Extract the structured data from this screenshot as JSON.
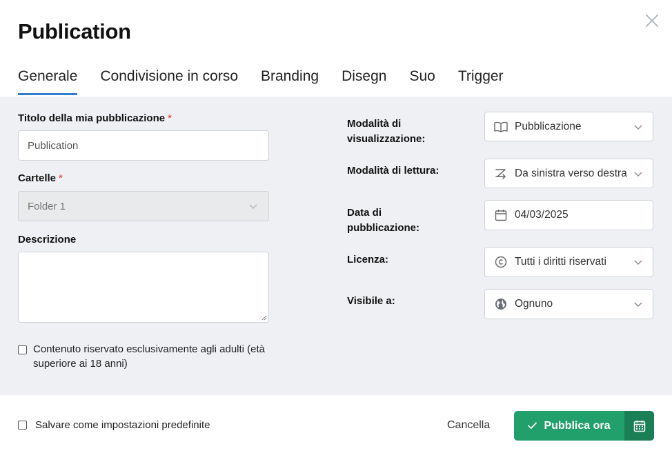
{
  "dialog": {
    "title": "Publication"
  },
  "tabs": [
    {
      "label": "Generale",
      "active": true
    },
    {
      "label": "Condivisione in corso"
    },
    {
      "label": "Branding"
    },
    {
      "label": "Disegn"
    },
    {
      "label": "Suo"
    },
    {
      "label": "Trigger"
    }
  ],
  "form": {
    "title_label": "Titolo della mia pubblicazione",
    "required_mark": "*",
    "title_value": "Publication",
    "folders_label": "Cartelle",
    "folder_value": "Folder 1",
    "description_label": "Descrizione",
    "description_value": "",
    "adult_content_label": "Contenuto riservato esclusivamente agli adulti (età superiore ai 18 anni)",
    "adult_content_checked": false
  },
  "settings": {
    "display_mode": {
      "label": "Modalità di visualizzazione:",
      "value": "Pubblicazione",
      "icon": "book-icon"
    },
    "reading_mode": {
      "label": "Modalità di lettura:",
      "value": "Da sinistra verso destra",
      "icon": "left-to-right-icon"
    },
    "publish_date": {
      "label": "Data di pubblicazione:",
      "value": "04/03/2025",
      "icon": "calendar-icon"
    },
    "license": {
      "label": "Licenza:",
      "value": "Tutti i diritti riservati",
      "icon": "copyright-icon"
    },
    "visibility": {
      "label": "Visibile a:",
      "value": "Ognuno",
      "icon": "globe-icon"
    }
  },
  "footer": {
    "save_default_label": "Salvare come impostazioni predefinite",
    "save_default_checked": false,
    "cancel_label": "Cancella",
    "publish_label": "Pubblica ora"
  },
  "colors": {
    "accent_tab": "#2f7bd3",
    "publish_button": "#22a06b",
    "schedule_button": "#1b7f55",
    "required": "#e0302f",
    "panel_bg": "#eef0f3"
  }
}
